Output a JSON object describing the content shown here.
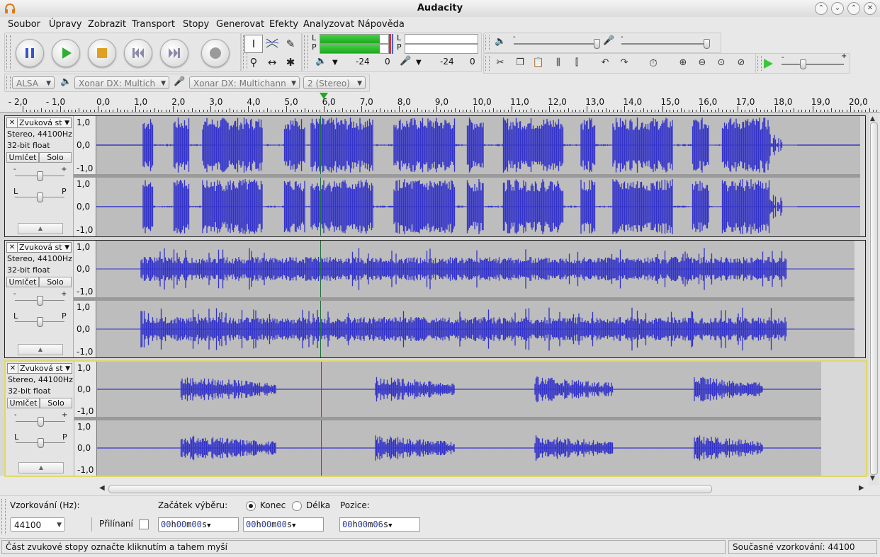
{
  "window": {
    "title": "Audacity"
  },
  "menu": [
    {
      "label": "Soubor"
    },
    {
      "label": "Úpravy"
    },
    {
      "label": "Zobrazit"
    },
    {
      "label": "Transport"
    },
    {
      "label": "Stopy"
    },
    {
      "label": "Generovat"
    },
    {
      "label": "Efekty"
    },
    {
      "label": "Analyzovat"
    },
    {
      "label": "Nápověda"
    }
  ],
  "meters": {
    "play_left": "L",
    "play_right": "P",
    "rec_left": "L",
    "rec_right": "P",
    "play_scale": [
      "-24",
      "0"
    ],
    "rec_scale": [
      "-24",
      "0"
    ],
    "play_level": 0.88
  },
  "device": {
    "host": "ALSA",
    "output": "Xonar DX: Multich",
    "input": "Xonar DX: Multichann",
    "channels": "2 (Stereo)"
  },
  "ruler": {
    "labels": [
      "- 2,0",
      "- 1,0",
      "0,0",
      "1,0",
      "2,0",
      "3,0",
      "4,0",
      "5,0",
      "6,0",
      "7,0",
      "8,0",
      "9,0",
      "10,0",
      "11,0",
      "12,0",
      "13,0",
      "14,0",
      "15,0",
      "16,0",
      "17,0",
      "18,0",
      "19,0",
      "20,0"
    ],
    "playhead_seconds": 6.0
  },
  "tracks": [
    {
      "name": "Zvuková st",
      "info1": "Stereo, 44100Hz",
      "info2": "32-bit float",
      "mute": "Umlčet",
      "solo": "Solo",
      "gain_minus": "-",
      "gain_plus": "+",
      "pan_left": "L",
      "pan_right": "P",
      "scale": [
        "1,0",
        "0,0",
        "-1,0",
        "1,0",
        "0,0",
        "-1,0"
      ],
      "selected": false
    },
    {
      "name": "Zvuková st",
      "info1": "Stereo, 44100Hz",
      "info2": "32-bit float",
      "mute": "Umlčet",
      "solo": "Solo",
      "gain_minus": "-",
      "gain_plus": "+",
      "pan_left": "L",
      "pan_right": "P",
      "scale": [
        "1,0",
        "0,0",
        "-1,0",
        "1,0",
        "0,0",
        "-1,0"
      ],
      "selected": false
    },
    {
      "name": "Zvuková st",
      "info1": "Stereo, 44100Hz",
      "info2": "32-bit float",
      "mute": "Umlčet",
      "solo": "Solo",
      "gain_minus": "-",
      "gain_plus": "+",
      "pan_left": "L",
      "pan_right": "P",
      "scale": [
        "1,0",
        "0,0",
        "-1,0",
        "1,0",
        "0,0",
        "-1,0"
      ],
      "selected": true
    }
  ],
  "selection": {
    "rate_label": "Vzorkování (Hz):",
    "rate_value": "44100",
    "snap_label": "Přilínaní",
    "start_label": "Začátek výběru:",
    "end_label": "Konec",
    "length_label": "Délka",
    "position_label": "Pozice:",
    "start_time": {
      "h": "00",
      "m": "00",
      "s": "00"
    },
    "end_time": {
      "h": "00",
      "m": "00",
      "s": "00"
    },
    "position_time": {
      "h": "00",
      "m": "00",
      "s": "06"
    }
  },
  "status": {
    "hint": "Část zvukové stopy označte kliknutím a tahem myší",
    "rate": "Současné vzorkování: 44100"
  },
  "colors": {
    "waveform": "#3232c8",
    "wave_bg": "#bdbdbd",
    "meter": "#2cc12c",
    "selected_track": "#e0d86a"
  }
}
